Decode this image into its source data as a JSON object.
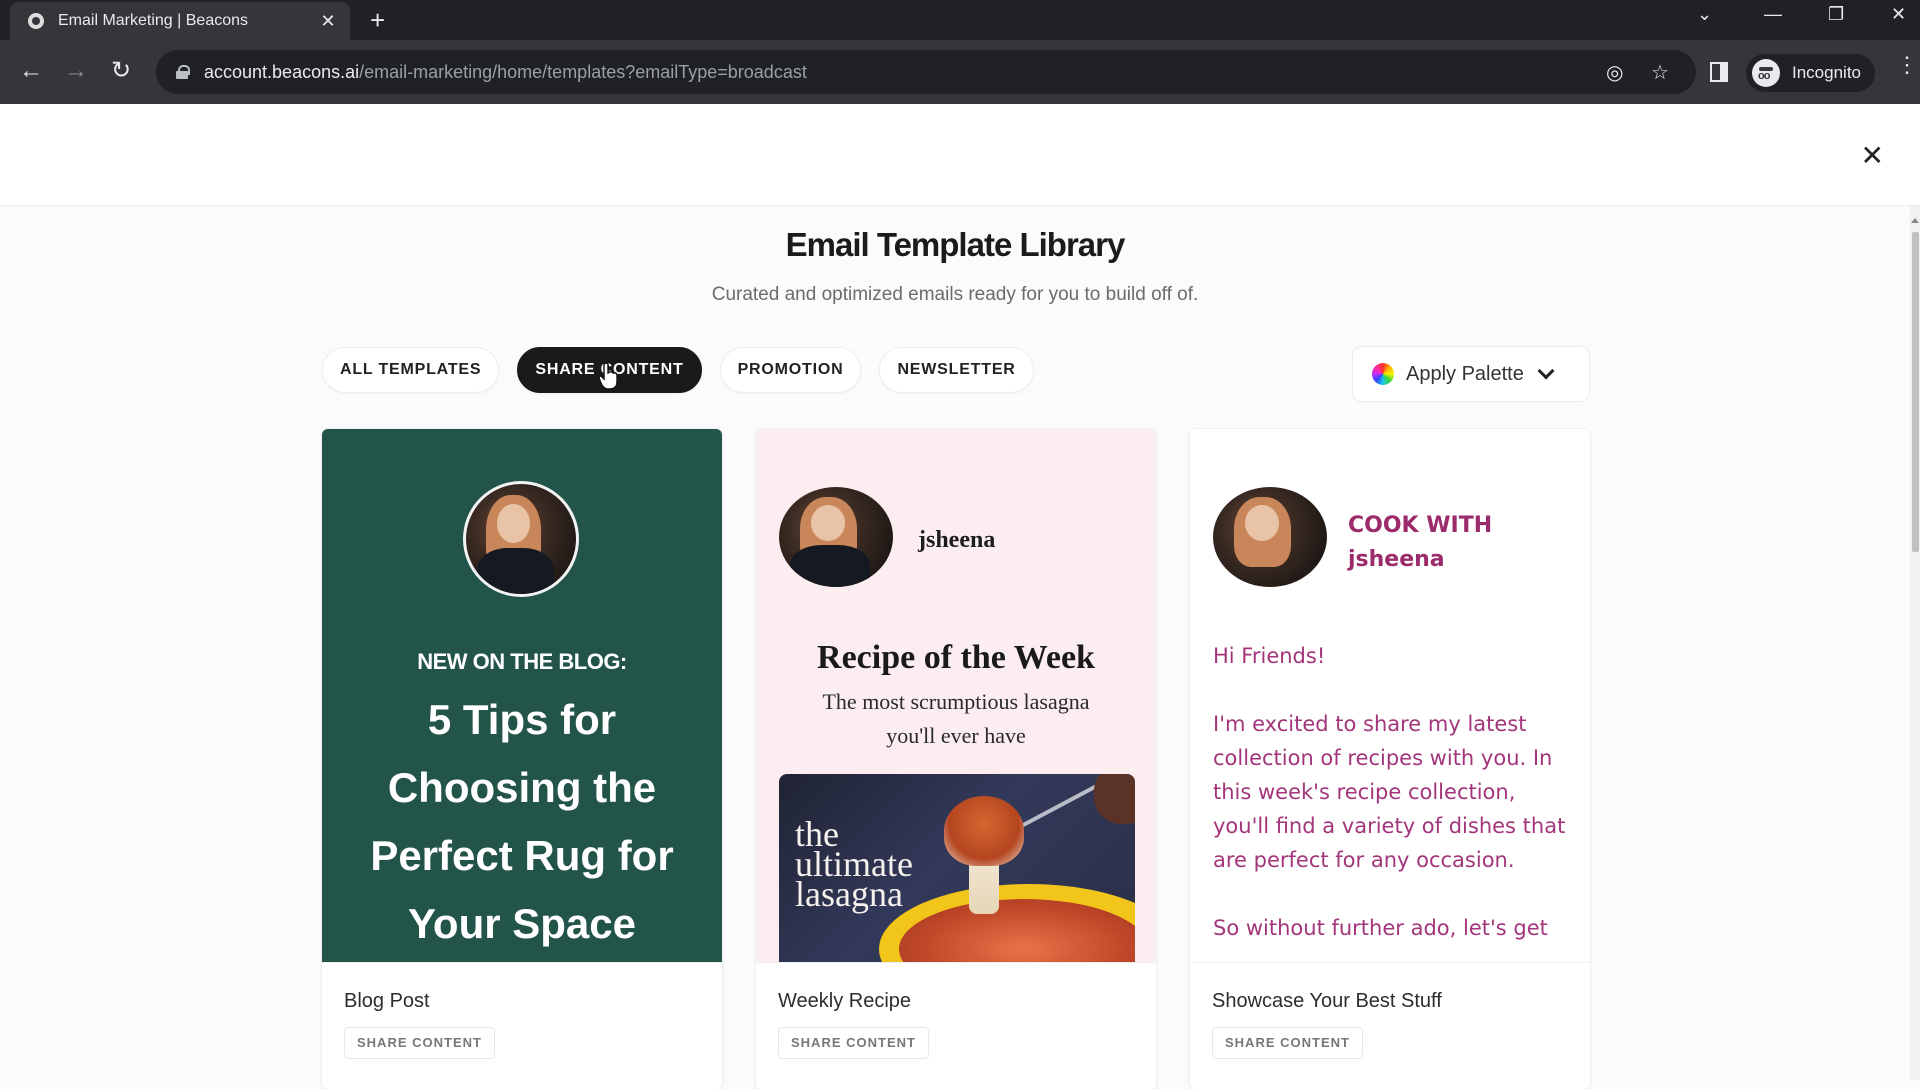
{
  "browser": {
    "tab_title": "Email Marketing | Beacons",
    "url_host": "account.beacons.ai",
    "url_path": "/email-marketing/home/templates?emailType=broadcast",
    "profile_label": "Incognito"
  },
  "page": {
    "title": "Email Template Library",
    "subtitle": "Curated and optimized emails ready for you to build off of."
  },
  "filters": [
    {
      "label": "ALL TEMPLATES",
      "active": false
    },
    {
      "label": "SHARE CONTENT",
      "active": true
    },
    {
      "label": "PROMOTION",
      "active": false
    },
    {
      "label": "NEWSLETTER",
      "active": false
    }
  ],
  "palette": {
    "label": "Apply Palette"
  },
  "templates": [
    {
      "name": "Blog Post",
      "category": "SHARE CONTENT",
      "preview": {
        "kicker": "NEW ON THE BLOG:",
        "headline": "5 Tips for Choosing the Perfect Rug for Your Space",
        "bg_color": "#23544a"
      }
    },
    {
      "name": "Weekly Recipe",
      "category": "SHARE CONTENT",
      "preview": {
        "username": "jsheena",
        "title": "Recipe of the Week",
        "subtitle": "The most scrumptious lasagna you'll ever have",
        "image_text_1": "the",
        "image_text_2": "ultimate",
        "image_text_3": "lasagna",
        "bg_color": "#fcedf0"
      }
    },
    {
      "name": "Showcase Your Best Stuff",
      "category": "SHARE CONTENT",
      "preview": {
        "brand_line_1": "COOK WITH",
        "brand_line_2": "jsheena",
        "greeting": "Hi Friends!",
        "body": "I'm excited to share my latest collection of recipes with you. In this week's recipe collection, you'll find a variety of dishes that are perfect for any occasion.",
        "body_cut": "So without further ado, let's get",
        "text_color": "#a3357a"
      }
    }
  ]
}
